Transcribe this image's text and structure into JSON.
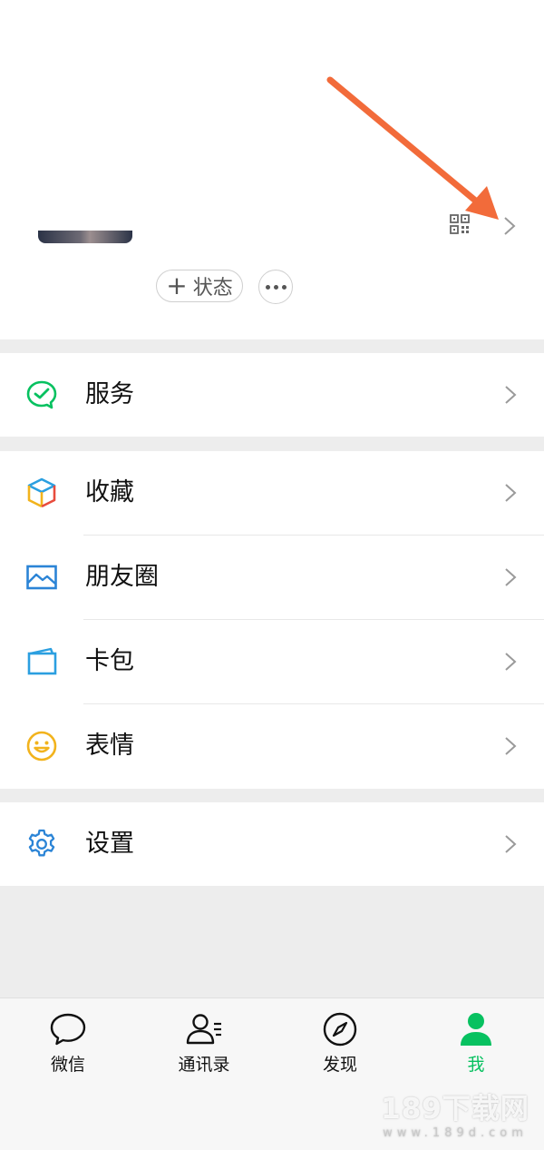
{
  "profile": {
    "status_label": "状态",
    "plus_glyph": "+"
  },
  "menu": {
    "services": "服务",
    "favorites": "收藏",
    "moments": "朋友圈",
    "cards": "卡包",
    "stickers": "表情",
    "settings": "设置"
  },
  "tabs": [
    {
      "label": "微信",
      "icon": "chat-bubble-icon",
      "active": false
    },
    {
      "label": "通讯录",
      "icon": "contacts-icon",
      "active": false
    },
    {
      "label": "发现",
      "icon": "compass-icon",
      "active": false
    },
    {
      "label": "我",
      "icon": "person-icon",
      "active": true
    }
  ],
  "watermark": {
    "main": "189下载网",
    "sub": "www.189d.com"
  },
  "colors": {
    "accent_green": "#07c160",
    "annotation_arrow": "#f26b3a",
    "background": "#ededed"
  }
}
